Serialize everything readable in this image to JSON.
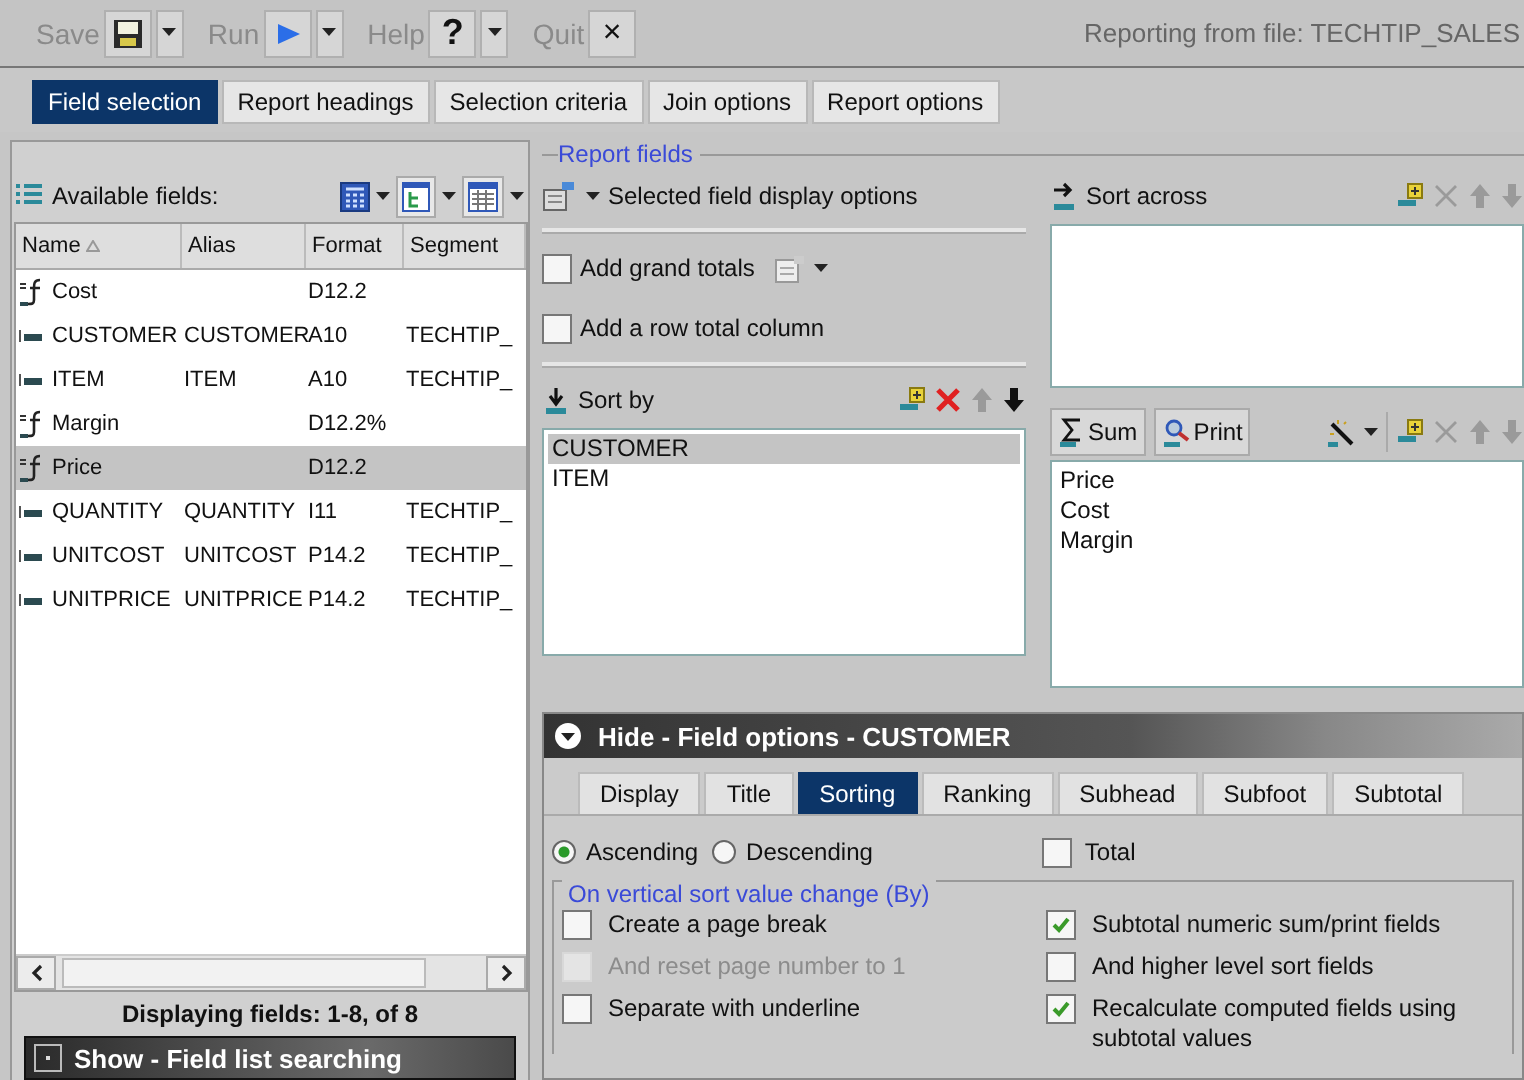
{
  "toolbar": {
    "items": [
      {
        "label": "Save",
        "kind": "save"
      },
      {
        "label": "Run",
        "kind": "run"
      },
      {
        "label": "Help",
        "kind": "help",
        "glyph": "?"
      },
      {
        "label": "Quit",
        "kind": "quit",
        "glyph": "×"
      }
    ],
    "source": "Reporting from file: TECHTIP_SALES"
  },
  "tabs": [
    {
      "label": "Field selection",
      "selected": true
    },
    {
      "label": "Report headings",
      "selected": false
    },
    {
      "label": "Selection criteria",
      "selected": false
    },
    {
      "label": "Join options",
      "selected": false
    },
    {
      "label": "Report options",
      "selected": false
    }
  ],
  "available_fields": {
    "title": "Available fields:",
    "columns": [
      "Name",
      "Alias",
      "Format",
      "Segment"
    ],
    "rows": [
      {
        "name": "Cost",
        "alias": "",
        "format": "D12.2",
        "segment": "",
        "kind": "computed",
        "selected": false
      },
      {
        "name": "CUSTOMER",
        "alias": "CUSTOMER",
        "format": "A10",
        "segment": "TECHTIP_",
        "kind": "field",
        "selected": false
      },
      {
        "name": "ITEM",
        "alias": "ITEM",
        "format": "A10",
        "segment": "TECHTIP_",
        "kind": "field",
        "selected": false
      },
      {
        "name": "Margin",
        "alias": "",
        "format": "D12.2%",
        "segment": "",
        "kind": "computed",
        "selected": false
      },
      {
        "name": "Price",
        "alias": "",
        "format": "D12.2",
        "segment": "",
        "kind": "computed",
        "selected": true
      },
      {
        "name": "QUANTITY",
        "alias": "QUANTITY",
        "format": "I11",
        "segment": "TECHTIP_",
        "kind": "field",
        "selected": false
      },
      {
        "name": "UNITCOST",
        "alias": "UNITCOST",
        "format": "P14.2",
        "segment": "TECHTIP_",
        "kind": "field",
        "selected": false
      },
      {
        "name": "UNITPRICE",
        "alias": "UNITPRICE",
        "format": "P14.2",
        "segment": "TECHTIP_",
        "kind": "field",
        "selected": false
      }
    ],
    "status": "Displaying fields: 1-8, of 8",
    "search_panel": "Show - Field list searching"
  },
  "report_fields": {
    "legend": "Report fields",
    "display_options": "Selected field display options",
    "totals": [
      {
        "label": "Add grand totals",
        "checked": false
      },
      {
        "label": "Add a row total column",
        "checked": false
      }
    ],
    "sort_by": {
      "title": "Sort by",
      "items": [
        {
          "label": "CUSTOMER",
          "selected": true
        },
        {
          "label": "ITEM",
          "selected": false
        }
      ]
    },
    "sort_across": {
      "title": "Sort across"
    },
    "measures": {
      "buttons": [
        "Sum",
        "Print"
      ],
      "items": [
        {
          "label": "Price",
          "selected": false
        },
        {
          "label": "Cost",
          "selected": false
        },
        {
          "label": "Margin",
          "selected": false
        }
      ]
    }
  },
  "field_options": {
    "title": "Hide - Field options - CUSTOMER",
    "tabs": [
      {
        "label": "Display",
        "selected": false
      },
      {
        "label": "Title",
        "selected": false
      },
      {
        "label": "Sorting",
        "selected": true
      },
      {
        "label": "Ranking",
        "selected": false
      },
      {
        "label": "Subhead",
        "selected": false
      },
      {
        "label": "Subfoot",
        "selected": false
      },
      {
        "label": "Subtotal",
        "selected": false
      }
    ],
    "order": [
      {
        "label": "Ascending",
        "selected": true
      },
      {
        "label": "Descending",
        "selected": false
      }
    ],
    "total": {
      "label": "Total",
      "checked": false
    },
    "group_legend": "On vertical sort value change (By)",
    "left_options": [
      {
        "label": "Create a page break",
        "checked": false,
        "disabled": false
      },
      {
        "label": "And reset page number to 1",
        "checked": false,
        "disabled": true
      },
      {
        "label": "Separate with underline",
        "checked": false,
        "disabled": false
      }
    ],
    "right_options": [
      {
        "label": "Subtotal numeric sum/print fields",
        "checked": true,
        "disabled": false
      },
      {
        "label": "And higher level sort fields",
        "checked": false,
        "disabled": false
      },
      {
        "label": "Recalculate computed fields using subtotal values",
        "checked": true,
        "disabled": false
      }
    ]
  }
}
